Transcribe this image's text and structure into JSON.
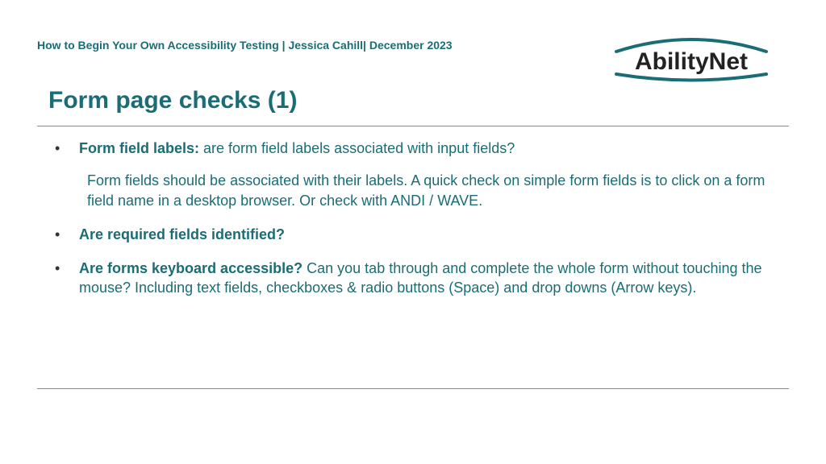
{
  "header": {
    "breadcrumb": "How to Begin Your Own Accessibility Testing | Jessica Cahill| December 2023"
  },
  "logo": {
    "name": "AbilityNet"
  },
  "slide": {
    "title": "Form page checks (1)"
  },
  "bullets": {
    "b1": {
      "label": "Form field labels: ",
      "question": "are form field labels associated with input fields?",
      "detail": "Form fields should be associated with their labels. A quick check on simple form fields is to click on a form field name in a desktop browser. Or check with ANDI / WAVE."
    },
    "b2": {
      "label": "Are required fields identified?"
    },
    "b3": {
      "label": "Are forms keyboard accessible? ",
      "detail": "Can you tab through and complete the whole form without touching the mouse? Including text fields, checkboxes & radio buttons (Space) and drop downs (Arrow keys)."
    }
  }
}
